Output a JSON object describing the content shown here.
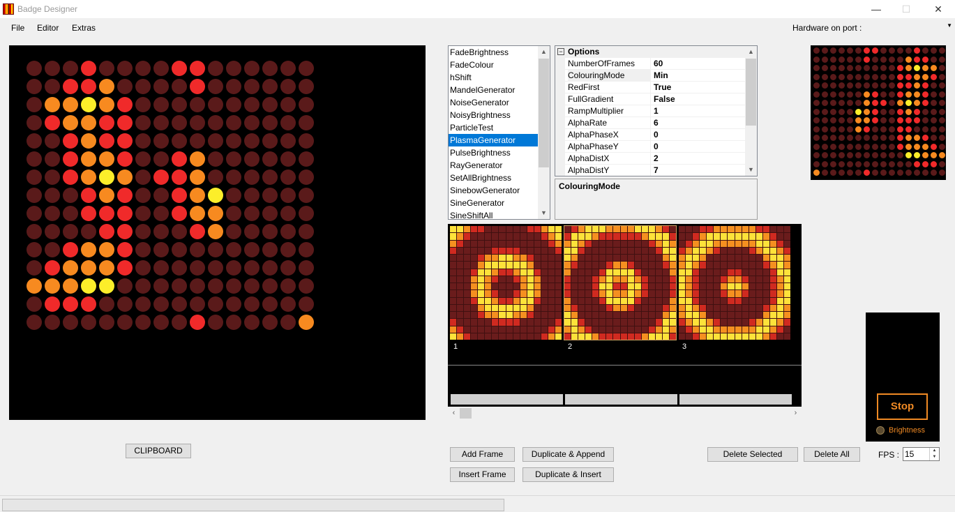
{
  "window": {
    "title": "Badge Designer",
    "minimize": "—",
    "maximize": "☐",
    "close": "✕"
  },
  "menu": {
    "items": [
      "File",
      "Editor",
      "Extras"
    ],
    "hardware_label": "Hardware on port :"
  },
  "clipboard_label": "CLIPBOARD",
  "generators": {
    "items": [
      "FadeBrightness",
      "FadeColour",
      "hShift",
      "MandelGenerator",
      "NoiseGenerator",
      "NoisyBrightness",
      "ParticleTest",
      "PlasmaGenerator",
      "PulseBrightness",
      "RayGenerator",
      "SetAllBrightness",
      "SinebowGenerator",
      "SineGenerator",
      "SineShiftAll"
    ],
    "selected": "PlasmaGenerator"
  },
  "properties": {
    "category": "Options",
    "rows": [
      {
        "name": "NumberOfFrames",
        "value": "60"
      },
      {
        "name": "ColouringMode",
        "value": "Min"
      },
      {
        "name": "RedFirst",
        "value": "True"
      },
      {
        "name": "FullGradient",
        "value": "False"
      },
      {
        "name": "RampMultiplier",
        "value": "1"
      },
      {
        "name": "AlphaRate",
        "value": "6"
      },
      {
        "name": "AlphaPhaseX",
        "value": "0"
      },
      {
        "name": "AlphaPhaseY",
        "value": "0"
      },
      {
        "name": "AlphaDistX",
        "value": "2"
      },
      {
        "name": "AlphaDistY",
        "value": "7"
      }
    ],
    "description": "ColouringMode"
  },
  "frames": {
    "labels": [
      "1",
      "2",
      "3"
    ],
    "selected_index": 1
  },
  "buttons": {
    "add_frame": "Add Frame",
    "duplicate_append": "Duplicate & Append",
    "insert_frame": "Insert Frame",
    "duplicate_insert": "Duplicate & Insert",
    "delete_selected": "Delete Selected",
    "delete_all": "Delete All"
  },
  "playback": {
    "stop_label": "Stop",
    "brightness_label": "Brightness",
    "fps_label": "FPS :",
    "fps_value": "15"
  },
  "colors": {
    "accent": "#f08a24",
    "selection": "#0078d7",
    "led_off": "#5a1a1a"
  },
  "led_matrix": {
    "rows": [
      "0001000011000000",
      "0011200001000000",
      "0223210000000000",
      "0122110000000000",
      "0012110000000000",
      "0012210012000000",
      "0012320112000000",
      "0001210012300000",
      "0001110012200000",
      "0000110001200000",
      "0012210000000000",
      "0122210000000000",
      "2223300000000000",
      "0111000000000000",
      "0000000001000002"
    ]
  }
}
